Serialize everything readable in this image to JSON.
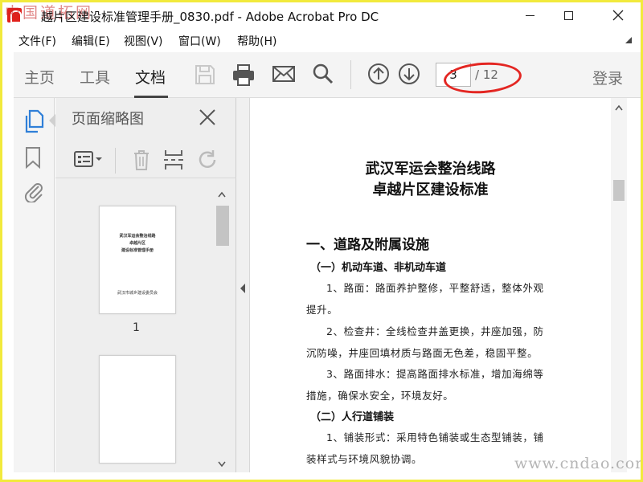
{
  "window": {
    "title": "越片区建设标准管理手册_0830.pdf - Adobe Acrobat Pro DC",
    "watermark_top": "中国道拓网",
    "watermark_bottom": "www.cndao.com"
  },
  "menu": [
    "文件(F)",
    "编辑(E)",
    "视图(V)",
    "窗口(W)",
    "帮助(H)"
  ],
  "toolbar": {
    "tabs": [
      {
        "label": "主页",
        "active": false
      },
      {
        "label": "工具",
        "active": false
      },
      {
        "label": "文档",
        "active": true
      }
    ],
    "current_page": "3",
    "total_pages": "/ 12",
    "login_label": "登录",
    "icons": [
      "save-icon",
      "print-icon",
      "email-icon",
      "search-icon",
      "page-up-icon",
      "page-down-icon"
    ],
    "highlight_color": "#e32622"
  },
  "sidebar": {
    "icons": [
      "pages-icon",
      "bookmark-icon",
      "attachment-icon"
    ]
  },
  "thumbnails": {
    "title": "页面缩略图",
    "page1_number": "1",
    "page1_lines": [
      "武汉军运会整治线路",
      "卓越片区",
      "建设标准管理手册"
    ],
    "page1_footer": "武汉市城乡建设委员会"
  },
  "document": {
    "title_line1": "武汉军运会整治线路",
    "title_line2": "卓越片区建设标准",
    "heading1": "一、道路及附属设施",
    "section1": "（一）机动车道、非机动车道",
    "p1_line1": "1、路面：路面养护整修，平整舒适，整体外观",
    "p1_line2": "提升。",
    "p2_line1": "2、检查井：全线检查井盖更换，井座加强，防",
    "p2_line2": "沉防噪，井座回填材质与路面无色差，稳固平整。",
    "p3_line1": "3、路面排水：提高路面排水标准，增加海绵等",
    "p3_line2": "措施，确保水安全，环境友好。",
    "section2": "（二）人行道铺装",
    "p4_line1": "1、铺装形式：采用特色铺装或生态型铺装，铺",
    "p4_line2": "装样式与环境风貌协调。"
  }
}
